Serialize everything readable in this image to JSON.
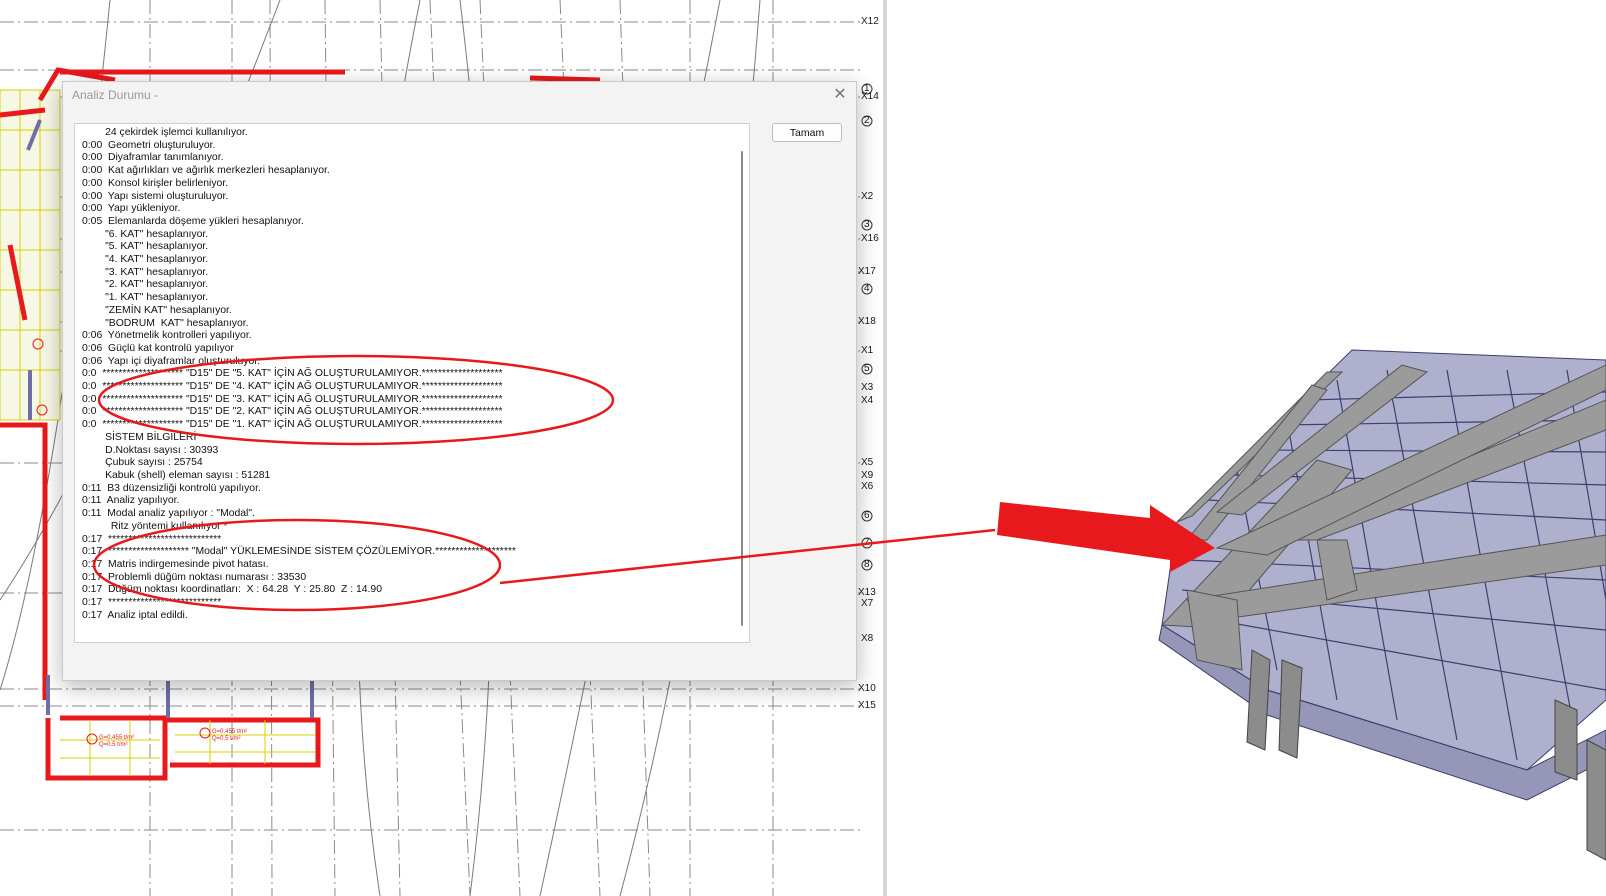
{
  "dialog": {
    "title": "Analiz Durumu -",
    "close_glyph": "✕",
    "ok_label": "Tamam",
    "log_lines": [
      "        24 çekirdek işlemci kullanılıyor.",
      "0:00  Geometri oluşturuluyor.",
      "0:00  Diyaframlar tanımlanıyor.",
      "0:00  Kat ağırlıkları ve ağırlık merkezleri hesaplanıyor.",
      "0:00  Konsol kirişler belirleniyor.",
      "0:00  Yapı sistemi oluşturuluyor.",
      "0:00  Yapı yükleniyor.",
      "0:05  Elemanlarda döşeme yükleri hesaplanıyor.",
      "        \"6. KAT\" hesaplanıyor.",
      "        \"5. KAT\" hesaplanıyor.",
      "        \"4. KAT\" hesaplanıyor.",
      "        \"3. KAT\" hesaplanıyor.",
      "        \"2. KAT\" hesaplanıyor.",
      "        \"1. KAT\" hesaplanıyor.",
      "        \"ZEMİN KAT\" hesaplanıyor.",
      "        \"BODRUM  KAT\" hesaplanıyor.",
      "0:06  Yönetmelik kontrolleri yapılıyor.",
      "0:06  Güçlü kat kontrolü yapılıyor",
      "0:06  Yapı içi diyaframlar oluşturuluyor.",
      "0:0  ******************** \"D15\" DE \"5. KAT\" İÇİN AĞ OLUŞTURULAMIYOR.********************",
      "0:0  ******************** \"D15\" DE \"4. KAT\" İÇİN AĞ OLUŞTURULAMIYOR.********************",
      "0:0  ******************** \"D15\" DE \"3. KAT\" İÇİN AĞ OLUŞTURULAMIYOR.********************",
      "0:0  ******************** \"D15\" DE \"2. KAT\" İÇİN AĞ OLUŞTURULAMIYOR.********************",
      "0:0  ******************** \"D15\" DE \"1. KAT\" İÇİN AĞ OLUŞTURULAMIYOR.********************",
      "        SİSTEM BİLGİLERİ",
      "        D.Noktası sayısı : 30393",
      "        Çubuk sayısı : 25754",
      "        Kabuk (shell) eleman sayısı : 51281",
      "0:11  B3 düzensizliği kontrolü yapılıyor.",
      "0:11  Analiz yapılıyor.",
      "0:11  Modal analiz yapılıyor : \"Modal\".",
      "          Ritz yöntemi kullanılıyor *",
      "0:17  ****************************",
      "0:17  ******************** \"Modal\" YÜKLEMESİNDE SİSTEM ÇÖZÜLEMİYOR.********************",
      "0:17  Matris indirgemesinde pivot hatası.",
      "0:17  Problemli düğüm noktası numarası : 33530",
      "0:17  Düğüm noktası koordinatları:  X : 64.28  Y : 25.80  Z : 14.90",
      "0:17  ****************************",
      "0:17  Analiz iptal edildi."
    ]
  },
  "grid_labels": [
    "X12",
    "1",
    "X14",
    "2",
    "X2",
    "3",
    "X16",
    "X17",
    "4",
    "X18",
    "X1",
    "5",
    "X3",
    "X4",
    "X5",
    "X9",
    "X6",
    "6",
    "7",
    "8",
    "X13",
    "X7",
    "X8",
    "X10",
    "X15"
  ],
  "plan_texts": {
    "slab_a": "G=0.455 t/m²",
    "slab_a2": "Q=0.5 t/m²",
    "slab_b": "G=0.455 t/m²",
    "slab_b2": "Q=0.5 t/m²"
  },
  "colors": {
    "annotation_red": "#e8191c",
    "model_purple": "#6e6fa6",
    "beam_gray": "#9b9b9b"
  }
}
